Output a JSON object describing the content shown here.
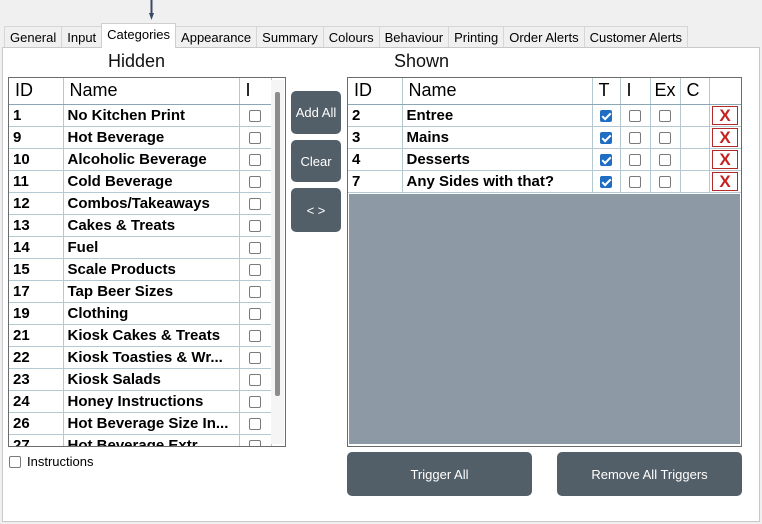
{
  "tabs": [
    "General",
    "Input",
    "Categories",
    "Appearance",
    "Summary",
    "Colours",
    "Behaviour",
    "Printing",
    "Order Alerts",
    "Customer Alerts"
  ],
  "active_tab": "Categories",
  "hidden": {
    "title": "Hidden",
    "columns": [
      "ID",
      "Name",
      "I"
    ],
    "rows": [
      {
        "id": "1",
        "name": "No Kitchen Print"
      },
      {
        "id": "9",
        "name": "Hot Beverage"
      },
      {
        "id": "10",
        "name": "Alcoholic Beverage"
      },
      {
        "id": "11",
        "name": "Cold Beverage"
      },
      {
        "id": "12",
        "name": "Combos/Takeaways"
      },
      {
        "id": "13",
        "name": "Cakes & Treats"
      },
      {
        "id": "14",
        "name": "Fuel"
      },
      {
        "id": "15",
        "name": "Scale Products"
      },
      {
        "id": "17",
        "name": "Tap Beer Sizes"
      },
      {
        "id": "19",
        "name": "Clothing"
      },
      {
        "id": "21",
        "name": "Kiosk Cakes & Treats"
      },
      {
        "id": "22",
        "name": "Kiosk Toasties & Wr..."
      },
      {
        "id": "23",
        "name": "Kiosk Salads"
      },
      {
        "id": "24",
        "name": "Honey Instructions"
      },
      {
        "id": "26",
        "name": "Hot Beverage Size In..."
      },
      {
        "id": "27",
        "name": "Hot Beverage Extr..."
      }
    ]
  },
  "shown": {
    "title": "Shown",
    "columns": [
      "ID",
      "Name",
      "T",
      "I",
      "Ex",
      "C"
    ],
    "remove_label": "X",
    "rows": [
      {
        "id": "2",
        "name": "Entree",
        "t": true,
        "i": false,
        "ex": false
      },
      {
        "id": "3",
        "name": "Mains",
        "t": true,
        "i": false,
        "ex": false
      },
      {
        "id": "4",
        "name": "Desserts",
        "t": true,
        "i": false,
        "ex": false
      },
      {
        "id": "7",
        "name": "Any Sides with that?",
        "t": true,
        "i": false,
        "ex": false
      }
    ]
  },
  "buttons": {
    "add_all": "Add All",
    "clear": "Clear",
    "swap": "< >",
    "trigger_all": "Trigger All",
    "remove_all_triggers": "Remove All Triggers"
  },
  "instructions_label": "Instructions",
  "colors": {
    "button": "#535f68",
    "checked": "#1f6ec4",
    "remove": "#c42121",
    "shown_empty": "#8d9aa5"
  }
}
